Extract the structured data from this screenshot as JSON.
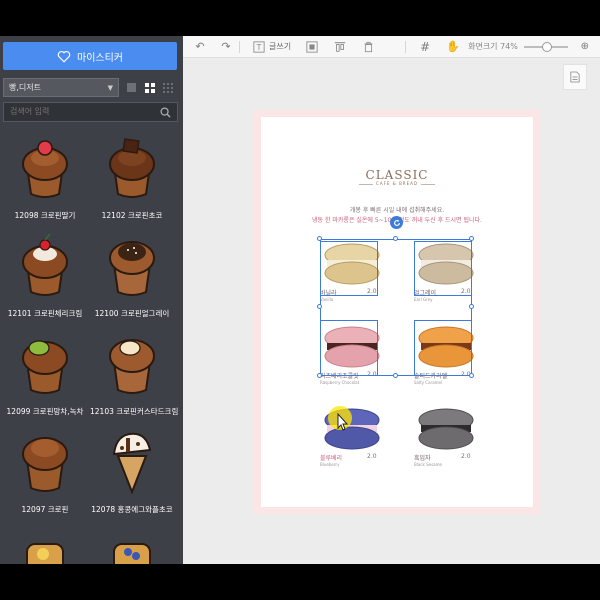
{
  "sidebar": {
    "my_sticker_label": "마이스티커",
    "category_value": "빵,디저트",
    "search_placeholder": "검색어 입력",
    "items": [
      {
        "label": "12098 크로핀딸기"
      },
      {
        "label": "12102 크로핀초코"
      },
      {
        "label": "12101 크로핀체리크림"
      },
      {
        "label": "12100 크로핀얼그레이"
      },
      {
        "label": "12099 크로핀망차,녹차"
      },
      {
        "label": "12103 크로핀커스타드크림"
      },
      {
        "label": "12097 크로핀"
      },
      {
        "label": "12078 홍콩에그와플초코"
      }
    ]
  },
  "toolbar": {
    "text_label": "글쓰기",
    "zoom_label": "화면크기 74%"
  },
  "page": {
    "title": "CLASSIC",
    "subtitle": "CAFE & BREAD",
    "notice_1": "개봉 후 빠른 시일 내에 섭취해주세요.",
    "notice_2": "냉동 한 마카롱은 실온에 5~10분 정도 꺼내 두신 후 드시면 됩니다.",
    "products": [
      {
        "name": "바닐라",
        "sub": "Vanilla",
        "price": "2.0"
      },
      {
        "name": "얼그레이",
        "sub": "Earl Grey",
        "price": "2.0"
      },
      {
        "name": "라즈베리초콜릿",
        "sub": "Raspberry Chocolat",
        "price": "2.0"
      },
      {
        "name": "솔티드카라멜",
        "sub": "Salty Caramel",
        "price": "2.0"
      },
      {
        "name": "블루베리",
        "sub": "Blueberry",
        "price": "2.0"
      },
      {
        "name": "흑임자",
        "sub": "Black Sesame",
        "price": "2.0"
      }
    ]
  },
  "colors": {
    "accent": "#4a8cf0",
    "sidebar_bg": "#3d4047",
    "selection": "#3c7bd9"
  }
}
